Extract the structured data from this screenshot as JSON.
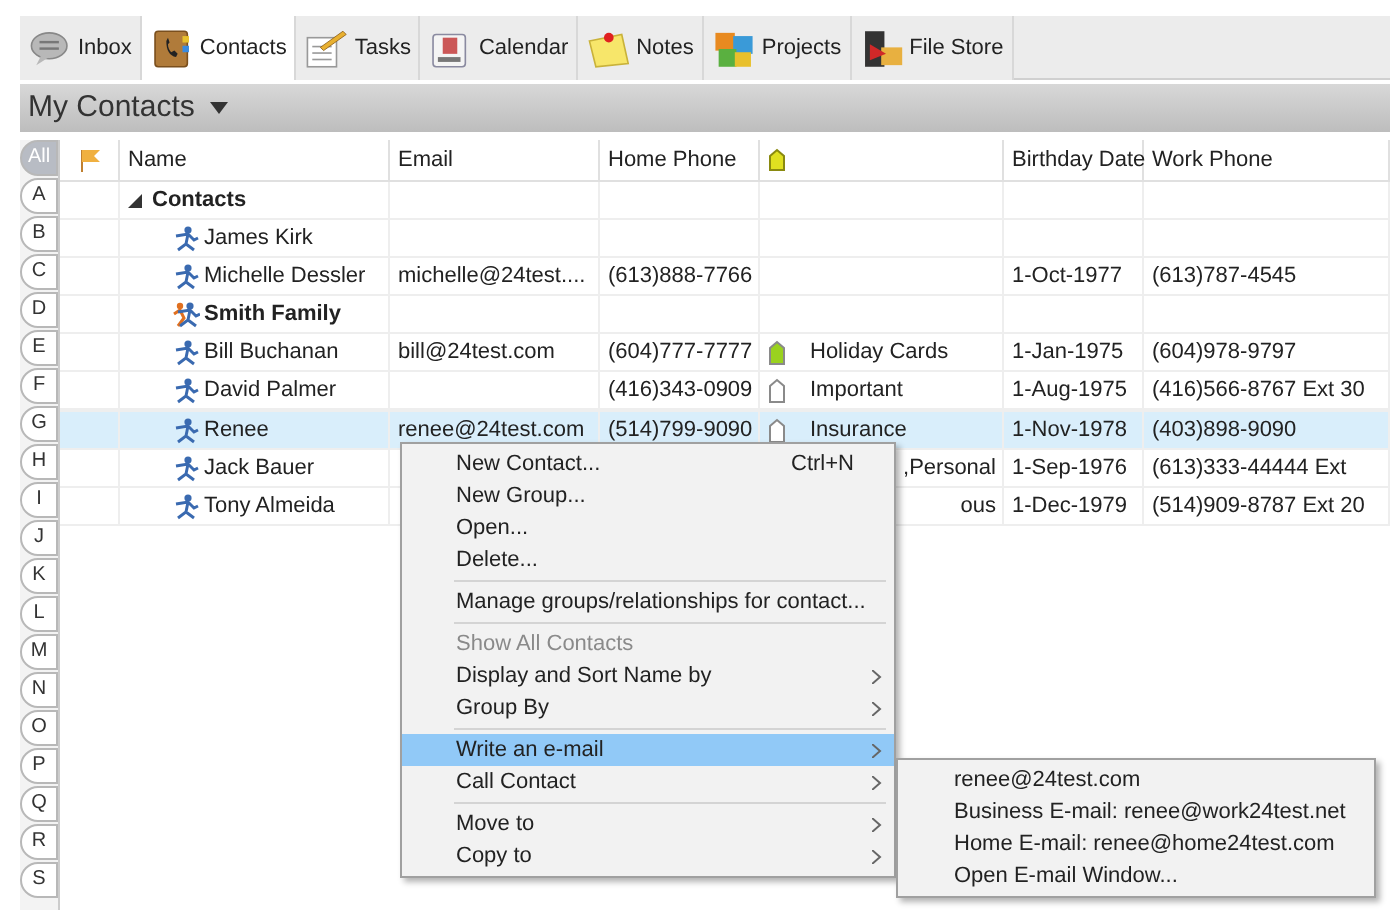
{
  "tabs": [
    {
      "label": "Inbox",
      "selected": false
    },
    {
      "label": "Contacts",
      "selected": true
    },
    {
      "label": "Tasks",
      "selected": false
    },
    {
      "label": "Calendar",
      "selected": false
    },
    {
      "label": "Notes",
      "selected": false
    },
    {
      "label": "Projects",
      "selected": false
    },
    {
      "label": "File Store",
      "selected": false
    }
  ],
  "view_title": "My Contacts",
  "index_letters": [
    {
      "label": "All",
      "selected": true
    },
    {
      "label": "A",
      "selected": false
    },
    {
      "label": "B",
      "selected": false
    },
    {
      "label": "C",
      "selected": false
    },
    {
      "label": "D",
      "selected": false
    },
    {
      "label": "E",
      "selected": false
    },
    {
      "label": "F",
      "selected": false
    },
    {
      "label": "G",
      "selected": false
    },
    {
      "label": "H",
      "selected": false
    },
    {
      "label": "I",
      "selected": false
    },
    {
      "label": "J",
      "selected": false
    },
    {
      "label": "K",
      "selected": false
    },
    {
      "label": "L",
      "selected": false
    },
    {
      "label": "M",
      "selected": false
    },
    {
      "label": "N",
      "selected": false
    },
    {
      "label": "O",
      "selected": false
    },
    {
      "label": "P",
      "selected": false
    },
    {
      "label": "Q",
      "selected": false
    },
    {
      "label": "R",
      "selected": false
    },
    {
      "label": "S",
      "selected": false
    }
  ],
  "table": {
    "columns": [
      "Name",
      "Email",
      "Home Phone",
      "Birthday Date",
      "Work Phone"
    ],
    "rows": [
      {
        "kind": "group",
        "name": "Contacts",
        "expanded": true,
        "selected": false
      },
      {
        "kind": "contact",
        "name": "James Kirk",
        "selected": false
      },
      {
        "kind": "contact",
        "name": "Michelle Dessler",
        "email": "michelle@24test....",
        "home_phone": "(613)888-7766",
        "birthday": "1-Oct-1977",
        "work_phone": "(613)787-4545",
        "selected": false
      },
      {
        "kind": "family",
        "name": "Smith Family",
        "selected": false
      },
      {
        "kind": "contact",
        "name": "Bill Buchanan",
        "email": "bill@24test.com",
        "home_phone": "(604)777-7777",
        "tag": "Holiday Cards",
        "color": "#9ad21e",
        "birthday": "1-Jan-1975",
        "work_phone": "(604)978-9797",
        "selected": false
      },
      {
        "kind": "contact",
        "name": "David Palmer",
        "home_phone": "(416)343-0909",
        "tag": "Important",
        "color": "#ffffff",
        "birthday": "1-Aug-1975",
        "work_phone": "(416)566-8767 Ext 30",
        "selected": false
      },
      {
        "kind": "contact",
        "name": "Renee",
        "email": "renee@24test.com",
        "home_phone": "(514)799-9090",
        "tag": "Insurance",
        "color": "#ffffff",
        "birthday": "1-Nov-1978",
        "work_phone": "(403)898-9090",
        "selected": true
      },
      {
        "kind": "contact",
        "name": "Jack Bauer",
        "tag": ",Personal",
        "birthday": "1-Sep-1976",
        "work_phone": "(613)333-44444 Ext",
        "selected": false
      },
      {
        "kind": "contact",
        "name": "Tony Almeida",
        "tag": "ous",
        "birthday": "1-Dec-1979",
        "work_phone": "(514)909-8787 Ext 20",
        "selected": false
      }
    ]
  },
  "context_menu": [
    {
      "kind": "item",
      "label": "New Contact...",
      "shortcut": "Ctrl+N",
      "disabled": false,
      "submenu": false,
      "selected": false
    },
    {
      "kind": "item",
      "label": "New Group...",
      "disabled": false,
      "submenu": false,
      "selected": false
    },
    {
      "kind": "item",
      "label": "Open...",
      "disabled": false,
      "submenu": false,
      "selected": false
    },
    {
      "kind": "item",
      "label": "Delete...",
      "disabled": false,
      "submenu": false,
      "selected": false
    },
    {
      "kind": "separator"
    },
    {
      "kind": "item",
      "label": "Manage groups/relationships for contact...",
      "disabled": false,
      "submenu": false,
      "selected": false
    },
    {
      "kind": "separator"
    },
    {
      "kind": "item",
      "label": "Show All Contacts",
      "disabled": true,
      "submenu": false,
      "selected": false
    },
    {
      "kind": "item",
      "label": "Display and Sort Name by",
      "disabled": false,
      "submenu": true,
      "selected": false
    },
    {
      "kind": "item",
      "label": "Group By",
      "disabled": false,
      "submenu": true,
      "selected": false
    },
    {
      "kind": "separator"
    },
    {
      "kind": "item",
      "label": "Write an e-mail",
      "disabled": false,
      "submenu": true,
      "selected": true
    },
    {
      "kind": "item",
      "label": "Call Contact",
      "disabled": false,
      "submenu": true,
      "selected": false
    },
    {
      "kind": "separator"
    },
    {
      "kind": "item",
      "label": "Move to",
      "disabled": false,
      "submenu": true,
      "selected": false
    },
    {
      "kind": "item",
      "label": "Copy to",
      "disabled": false,
      "submenu": true,
      "selected": false
    }
  ],
  "submenu": [
    "renee@24test.com",
    "Business E-mail: renee@work24test.net",
    "Home E-mail: renee@home24test.com",
    "Open E-mail Window..."
  ]
}
